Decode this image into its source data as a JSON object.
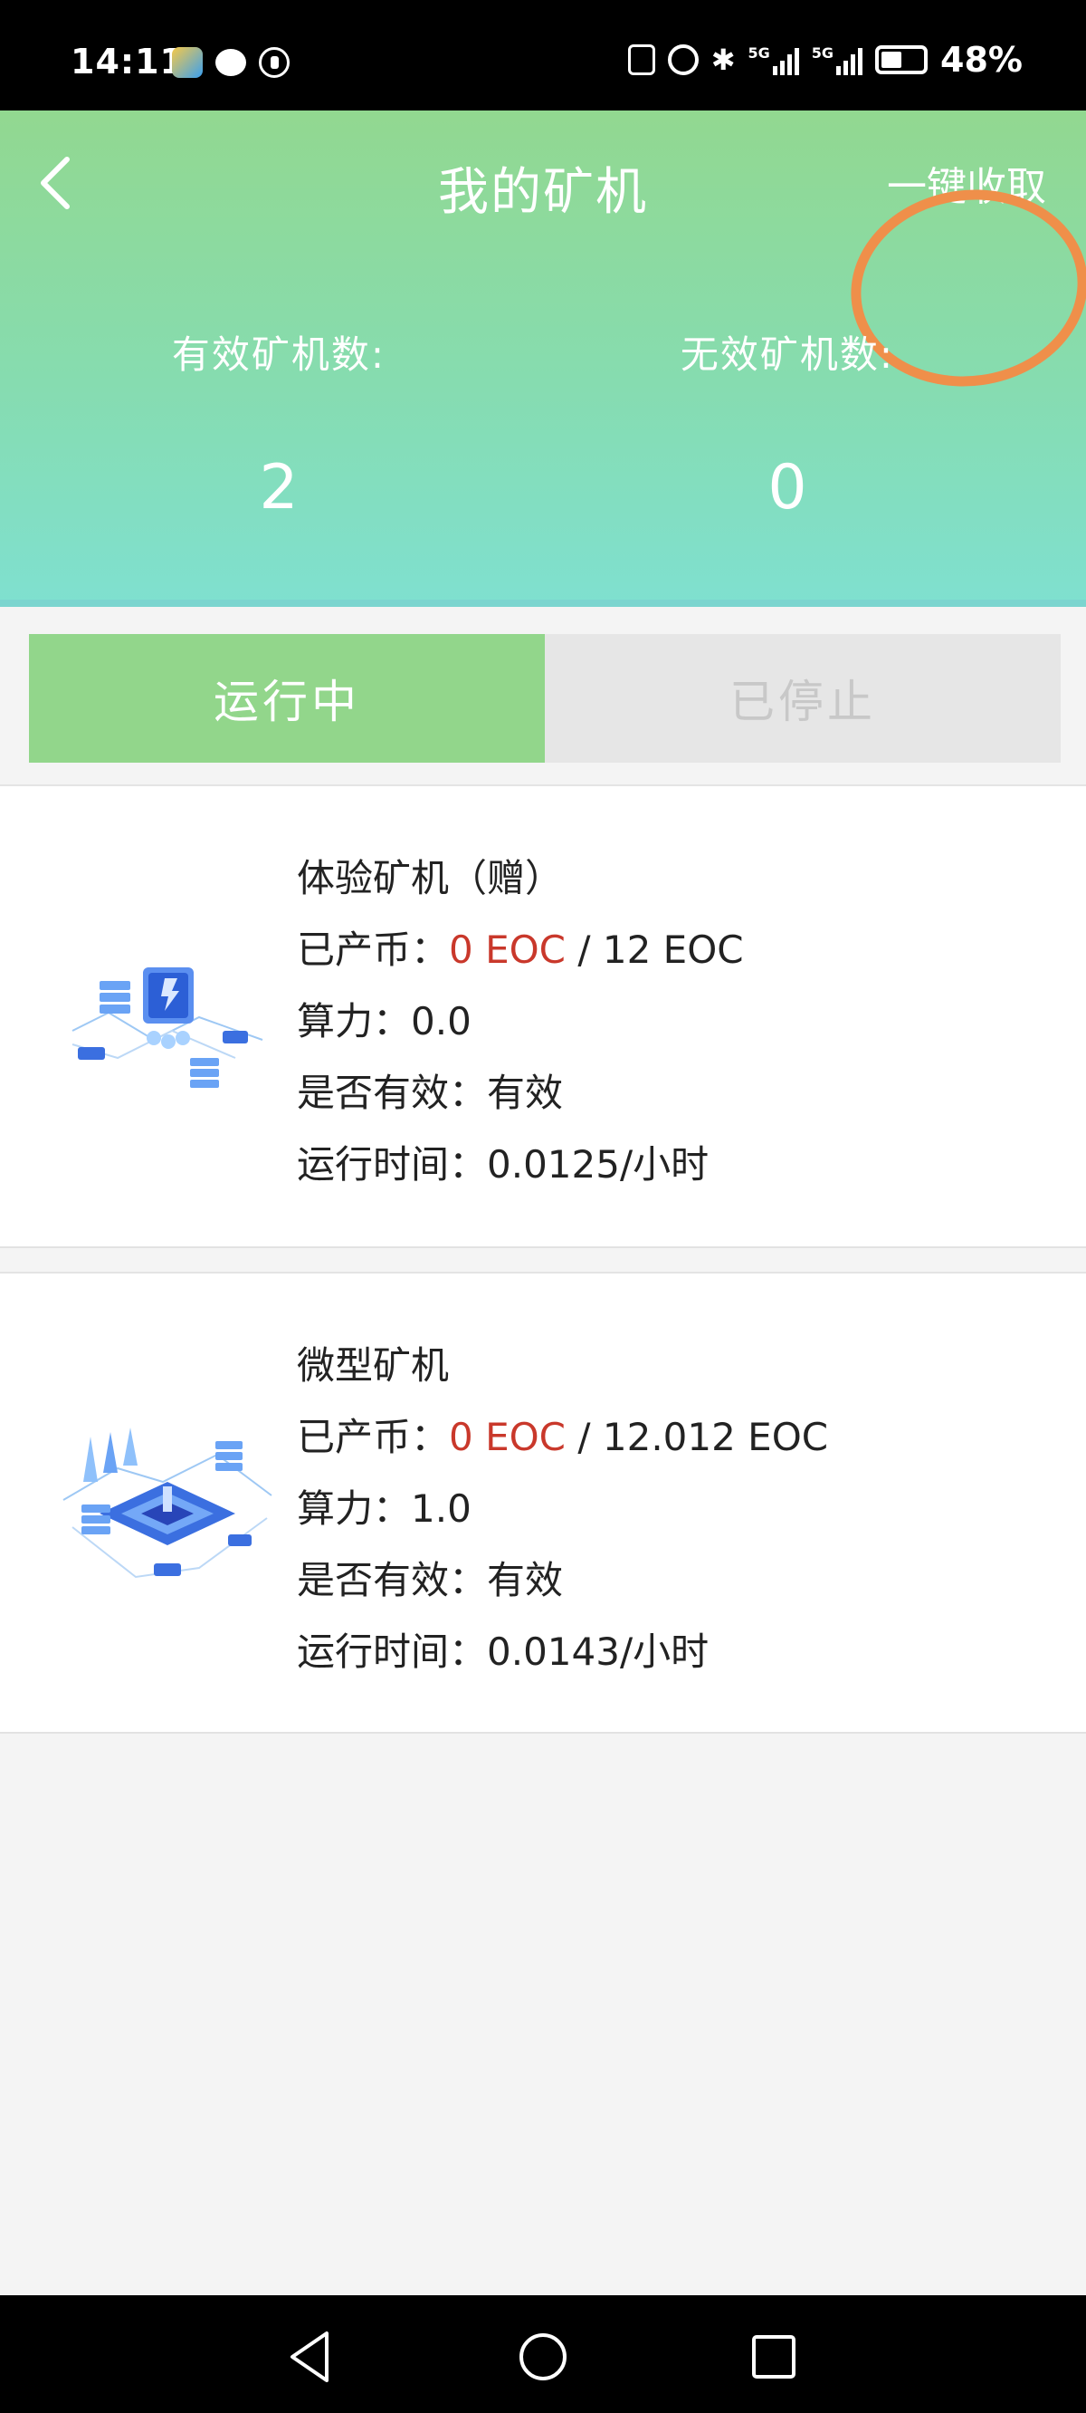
{
  "status_bar": {
    "time": "14:11",
    "network_5g_1": "5G",
    "network_5g_2": "5G",
    "battery": "48%"
  },
  "header": {
    "title": "我的矿机",
    "collect_all_label": "一键收取",
    "valid_label": "有效矿机数:",
    "valid_count": "2",
    "invalid_label": "无效矿机数:",
    "invalid_count": "0",
    "gradient_top": "#92d890",
    "gradient_bottom": "#7fe0d0",
    "highlight_color": "#ef8f4a"
  },
  "tabs": [
    {
      "label": "运行中",
      "active": true
    },
    {
      "label": "已停止",
      "active": false
    }
  ],
  "miners": [
    {
      "name": "体验矿机（赠）",
      "produced_label": "已产币：",
      "produced": "0 EOC",
      "produced_sep": " / ",
      "total": "12 EOC",
      "power_label": "算力：",
      "power": "0.0",
      "valid_label": "是否有效：",
      "valid": "有效",
      "runtime_label": "运行时间：",
      "runtime": "0.0125/小时",
      "icon": "mining-server-illustration"
    },
    {
      "name": "微型矿机",
      "produced_label": "已产币：",
      "produced": "0 EOC",
      "produced_sep": " / ",
      "total": "12.012 EOC",
      "power_label": "算力：",
      "power": "1.0",
      "valid_label": "是否有效：",
      "valid": "有效",
      "runtime_label": "运行时间：",
      "runtime": "0.0143/小时",
      "icon": "mining-platform-illustration"
    }
  ],
  "colors": {
    "accent_green": "#92d68b",
    "produced_red": "#c9382b"
  }
}
